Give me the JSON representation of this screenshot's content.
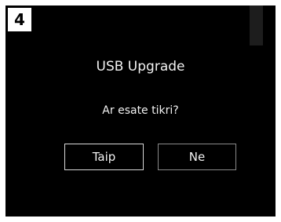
{
  "step": {
    "number": "4"
  },
  "dialog": {
    "title": "USB Upgrade",
    "message": "Ar esate tikri?",
    "buttons": {
      "yes_label": "Taip",
      "no_label": "Ne"
    }
  },
  "colors": {
    "screen_background": "#000000",
    "text": "#f2f2f2",
    "button_border": "#8a8a8a",
    "badge_background": "#ffffff"
  }
}
